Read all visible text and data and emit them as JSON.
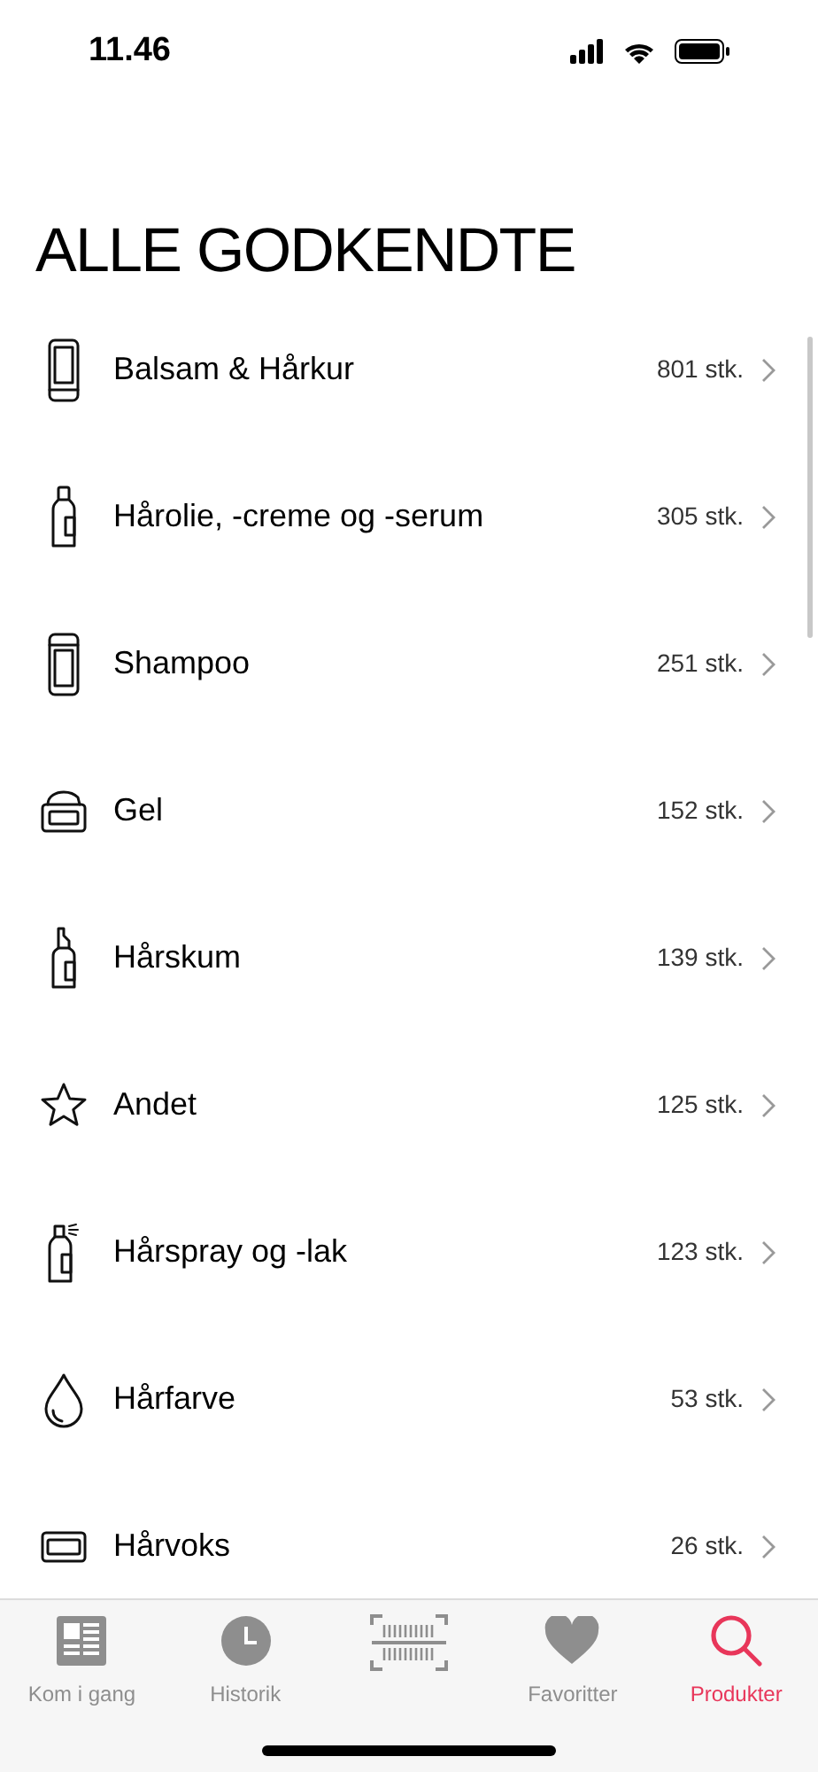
{
  "status_bar": {
    "time": "11.46"
  },
  "title": "ALLE GODKENDTE",
  "categories": [
    {
      "name": "Balsam & Hårkur",
      "count": "801 stk."
    },
    {
      "name": "Hårolie, -creme og -serum",
      "count": "305 stk."
    },
    {
      "name": "Shampoo",
      "count": "251 stk."
    },
    {
      "name": "Gel",
      "count": "152 stk."
    },
    {
      "name": "Hårskum",
      "count": "139 stk."
    },
    {
      "name": "Andet",
      "count": "125 stk."
    },
    {
      "name": "Hårspray og -lak",
      "count": "123 stk."
    },
    {
      "name": "Hårfarve",
      "count": "53 stk."
    },
    {
      "name": "Hårvoks",
      "count": "26 stk."
    }
  ],
  "tab_bar": [
    {
      "label": "Kom i gang",
      "selected": false
    },
    {
      "label": "Historik",
      "selected": false
    },
    {
      "selected": false
    },
    {
      "label": "Favoritter",
      "selected": false
    },
    {
      "label": "Produkter",
      "selected": true
    }
  ]
}
